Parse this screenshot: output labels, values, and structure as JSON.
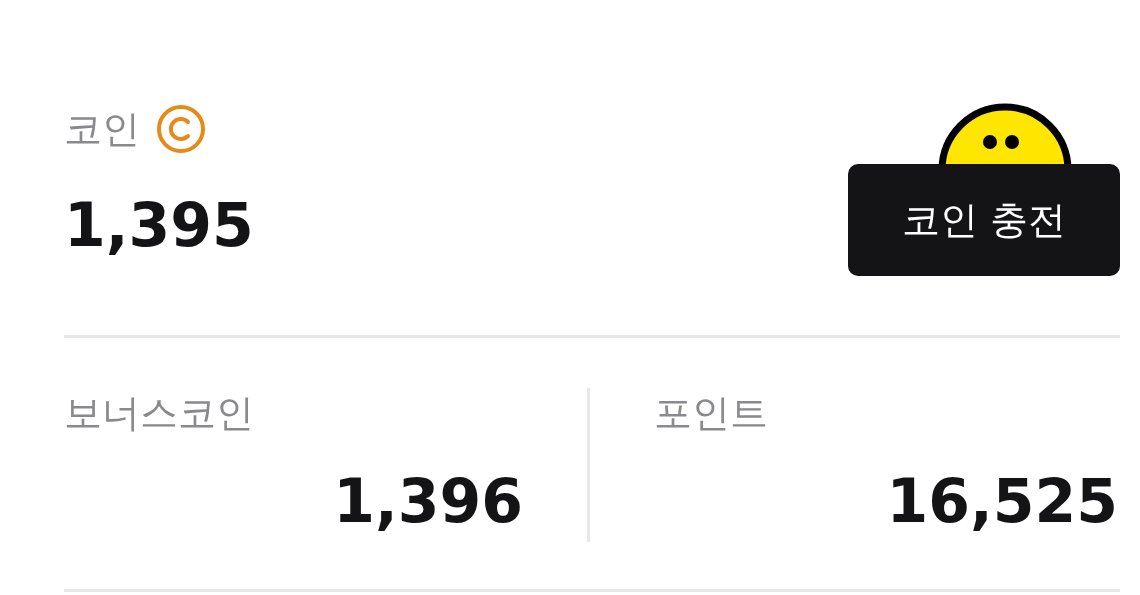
{
  "coin": {
    "label": "코인",
    "amount": "1,395"
  },
  "charge_button": {
    "label": "코인 충전"
  },
  "balances": [
    {
      "label": "보너스코인",
      "amount": "1,396"
    },
    {
      "label": "포인트",
      "amount": "16,525"
    }
  ]
}
